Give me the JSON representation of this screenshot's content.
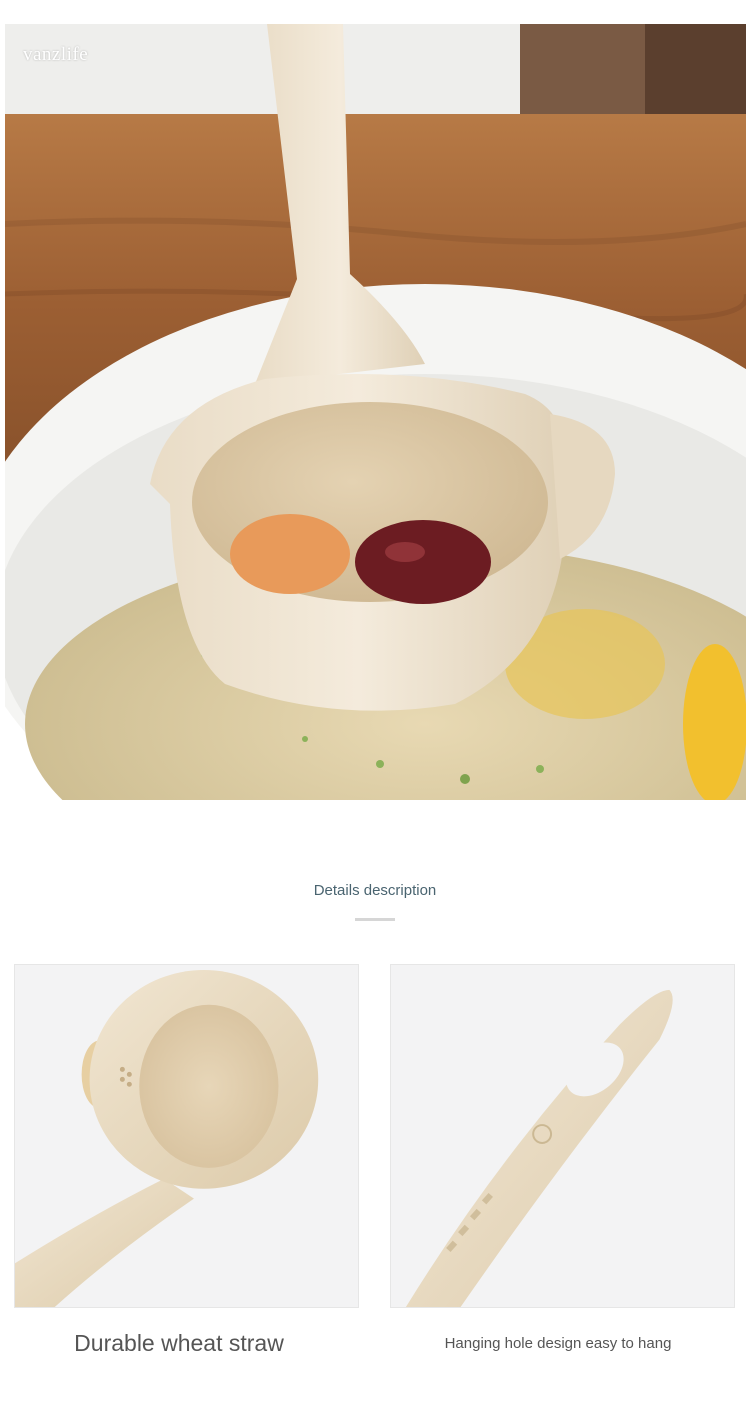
{
  "hero": {
    "watermark": "vanzlife",
    "image_description": "soup-ladle-over-bowl-photo"
  },
  "section": {
    "title": "Details description"
  },
  "details": [
    {
      "caption": "Durable wheat straw",
      "image": "ladle-bowl-closeup"
    },
    {
      "caption": "Hanging hole design easy to hang",
      "image": "ladle-handle-hole-closeup"
    }
  ],
  "colors": {
    "wheat": "#efe3cf",
    "table_wood": "#a5683a",
    "broth": "#d9c9a2",
    "section_title": "#4a6470"
  }
}
